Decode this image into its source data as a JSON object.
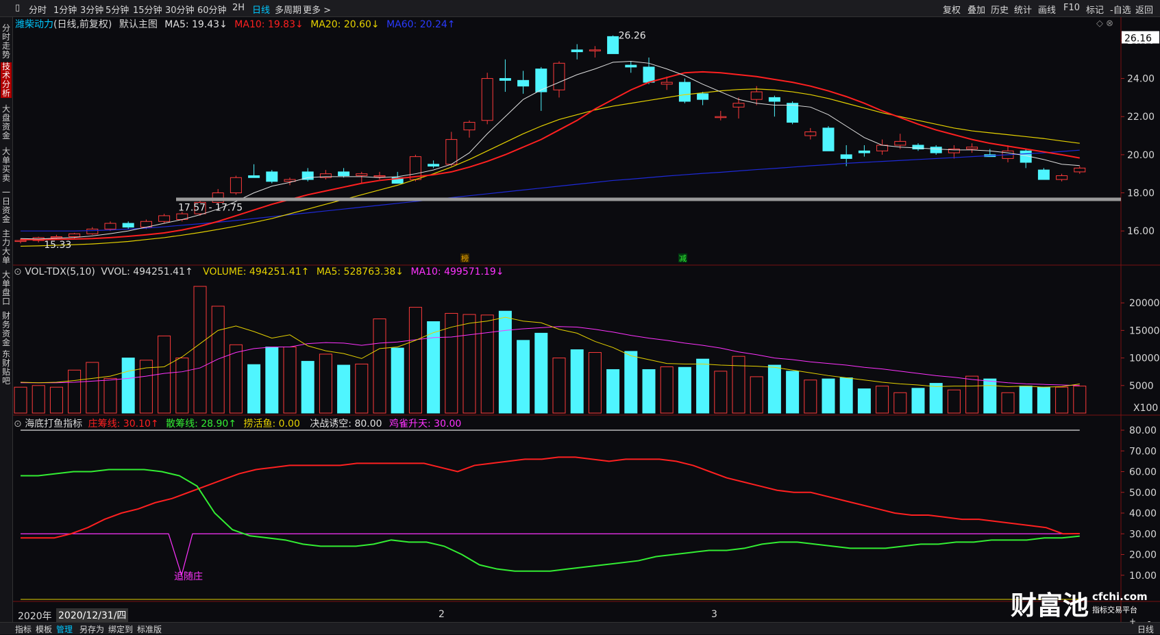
{
  "toolbar": {
    "left_items": [
      "分时",
      "1分钟",
      "3分钟",
      "5分钟",
      "15分钟",
      "30分钟",
      "60分钟",
      "2H",
      "日线",
      "多周期",
      "更多 >"
    ],
    "active_index": 8,
    "right_items": [
      "复权",
      "叠加",
      "历史",
      "统计",
      "画线",
      "F10",
      "标记",
      "-自选",
      "返回"
    ]
  },
  "sidebar": {
    "items": [
      "分时走势",
      "技术分析",
      "大盘资金",
      "大单买卖",
      "一日资金",
      "主力大单",
      "大单盘口",
      "财务资金",
      "东财贴吧"
    ],
    "active_index": 1
  },
  "main_header": {
    "stock": "潍柴动力",
    "mode": "(日线,前复权)",
    "template": "默认主图",
    "ma5": "MA5: 19.43↓",
    "ma10": "MA10: 19.83↓",
    "ma20": "MA20: 20.60↓",
    "ma60": "MA60: 20.24↑",
    "top_right_icons": "◇ ⊗"
  },
  "vol_header": {
    "name": "VOL-TDX(5,10)",
    "vvol": "VVOL: 494251.41↑",
    "volume": "VOLUME: 494251.41↑",
    "ma5": "MA5: 528763.38↓",
    "ma10": "MA10: 499571.19↓"
  },
  "ind_header": {
    "name": "海底打鱼指标",
    "l1": "庄筹线: 30.10↑",
    "l2": "散筹线: 28.90↑",
    "l3": "捞活鱼: 0.00",
    "l4": "决战诱空: 80.00",
    "l5": "鸡雀升天: 30.00"
  },
  "annotations": {
    "high": "26.26",
    "low": "15.33",
    "range": "17.57 - 17.75",
    "current_price": "26.16",
    "chase": "追随庄",
    "tag1": "榜",
    "tag2": "减",
    "vol_unit": "X100"
  },
  "date_axis": {
    "year": "2020年",
    "cursor_date": "2020/12/31/四",
    "labels": [
      "2",
      "3"
    ]
  },
  "bottom_tabs": [
    "指标",
    "模板",
    "管理",
    "另存为",
    "绑定到",
    "标准版"
  ],
  "bottom_active": 2,
  "bottom_right": [
    "日线",
    "+",
    "-"
  ],
  "watermark": {
    "brand": "财富池",
    "site": "cfchi.com",
    "slogan": "指标交易平台"
  },
  "colors": {
    "up": "#ff3b3b",
    "down": "#4ff5ff",
    "ma5": "#e0e0e0",
    "ma10": "#ff2020",
    "ma20": "#e6d200",
    "ma60": "#1e2ad8",
    "green": "#33ee33",
    "magenta": "#ff33ff"
  },
  "chart_data": [
    {
      "type": "candlestick",
      "title": "潍柴动力 (日线,前复权)",
      "ylim": [
        15,
        26.5
      ],
      "yticks": [
        "16.00",
        "18.00",
        "20.00",
        "22.00",
        "24.00",
        "26.00"
      ],
      "candles": [
        [
          15.5,
          15.6,
          15.35,
          15.5
        ],
        [
          15.5,
          15.7,
          15.4,
          15.65
        ],
        [
          15.65,
          15.8,
          15.55,
          15.7
        ],
        [
          15.7,
          15.9,
          15.6,
          15.85
        ],
        [
          15.85,
          16.2,
          15.8,
          16.1
        ],
        [
          16.1,
          16.5,
          16.0,
          16.4
        ],
        [
          16.4,
          16.5,
          16.1,
          16.2
        ],
        [
          16.2,
          16.6,
          16.1,
          16.5
        ],
        [
          16.5,
          16.9,
          16.4,
          16.8
        ],
        [
          16.6,
          17.0,
          16.5,
          16.9
        ],
        [
          16.9,
          17.6,
          16.8,
          17.5
        ],
        [
          17.5,
          18.2,
          17.4,
          18.0
        ],
        [
          18.0,
          18.9,
          17.9,
          18.8
        ],
        [
          18.9,
          19.5,
          18.8,
          18.8
        ],
        [
          19.1,
          19.2,
          18.5,
          18.6
        ],
        [
          18.6,
          18.8,
          18.4,
          18.7
        ],
        [
          19.1,
          19.3,
          18.6,
          18.7
        ],
        [
          18.8,
          19.2,
          18.7,
          19.0
        ],
        [
          19.1,
          19.3,
          18.8,
          18.9
        ],
        [
          18.9,
          19.1,
          18.5,
          19.0
        ],
        [
          18.9,
          19.1,
          18.7,
          18.9
        ],
        [
          18.8,
          19.1,
          18.6,
          18.5
        ],
        [
          18.7,
          20.0,
          18.6,
          19.9
        ],
        [
          19.5,
          19.7,
          19.3,
          19.4
        ],
        [
          19.5,
          21.2,
          19.4,
          20.8
        ],
        [
          21.3,
          21.8,
          20.9,
          21.7
        ],
        [
          21.8,
          24.3,
          21.6,
          24.0
        ],
        [
          24.0,
          25.0,
          23.3,
          23.9
        ],
        [
          23.9,
          24.4,
          23.2,
          23.6
        ],
        [
          24.5,
          24.6,
          22.3,
          23.3
        ],
        [
          23.4,
          24.9,
          23.0,
          24.8
        ],
        [
          25.5,
          25.8,
          25.0,
          25.4
        ],
        [
          25.5,
          25.7,
          25.1,
          25.5
        ],
        [
          26.2,
          26.26,
          25.3,
          25.3
        ],
        [
          24.7,
          24.9,
          24.3,
          24.6
        ],
        [
          24.6,
          25.1,
          23.7,
          23.8
        ],
        [
          23.7,
          24.1,
          23.4,
          23.8
        ],
        [
          23.8,
          24.0,
          22.7,
          22.8
        ],
        [
          23.2,
          23.3,
          22.6,
          22.9
        ],
        [
          22.0,
          22.3,
          21.8,
          22.0
        ],
        [
          22.5,
          23.0,
          21.9,
          22.7
        ],
        [
          22.9,
          23.6,
          22.6,
          23.3
        ],
        [
          23.0,
          23.1,
          22.0,
          22.8
        ],
        [
          22.7,
          22.8,
          21.6,
          21.7
        ],
        [
          21.0,
          21.4,
          20.8,
          21.2
        ],
        [
          21.4,
          21.5,
          20.2,
          20.2
        ],
        [
          20.0,
          20.5,
          19.4,
          19.8
        ],
        [
          20.2,
          20.5,
          19.9,
          20.1
        ],
        [
          20.2,
          20.8,
          20.0,
          20.5
        ],
        [
          20.5,
          21.1,
          20.3,
          20.7
        ],
        [
          20.5,
          20.6,
          20.2,
          20.3
        ],
        [
          20.4,
          20.5,
          20.0,
          20.1
        ],
        [
          20.1,
          20.5,
          19.8,
          20.3
        ],
        [
          20.3,
          20.6,
          20.1,
          20.4
        ],
        [
          20.0,
          20.3,
          19.9,
          19.9
        ],
        [
          19.8,
          20.5,
          19.6,
          20.2
        ],
        [
          20.2,
          20.3,
          19.3,
          19.6
        ],
        [
          19.2,
          19.3,
          18.7,
          18.7
        ],
        [
          18.7,
          19.0,
          18.6,
          18.9
        ],
        [
          19.1,
          19.4,
          19.0,
          19.3
        ]
      ],
      "ma5": [
        15.6,
        15.58,
        15.62,
        15.66,
        15.74,
        15.86,
        16.0,
        16.2,
        16.4,
        16.6,
        16.85,
        17.15,
        17.55,
        18.0,
        18.35,
        18.55,
        18.8,
        18.85,
        18.85,
        18.85,
        18.8,
        18.85,
        19.0,
        19.2,
        19.5,
        20.1,
        21.1,
        22.0,
        22.9,
        23.4,
        23.8,
        24.2,
        24.5,
        24.85,
        24.9,
        24.8,
        24.5,
        24.15,
        23.7,
        23.3,
        22.9,
        22.7,
        22.6,
        22.6,
        22.5,
        22.1,
        21.5,
        20.9,
        20.5,
        20.4,
        20.35,
        20.3,
        20.25,
        20.25,
        20.2,
        20.1,
        19.95,
        19.75,
        19.5,
        19.43
      ],
      "ma10": [
        15.55,
        15.55,
        15.56,
        15.58,
        15.6,
        15.65,
        15.72,
        15.8,
        15.9,
        16.05,
        16.25,
        16.5,
        16.8,
        17.1,
        17.4,
        17.65,
        17.9,
        18.1,
        18.3,
        18.5,
        18.65,
        18.75,
        18.85,
        18.95,
        19.1,
        19.35,
        19.65,
        20.0,
        20.4,
        20.8,
        21.3,
        21.8,
        22.4,
        22.9,
        23.4,
        23.8,
        24.05,
        24.3,
        24.35,
        24.3,
        24.2,
        24.1,
        23.95,
        23.8,
        23.6,
        23.35,
        23.05,
        22.7,
        22.3,
        21.95,
        21.6,
        21.3,
        21.05,
        20.8,
        20.6,
        20.45,
        20.3,
        20.15,
        20.0,
        19.83
      ],
      "ma20": [
        15.2,
        15.22,
        15.25,
        15.28,
        15.32,
        15.38,
        15.45,
        15.55,
        15.65,
        15.78,
        15.92,
        16.08,
        16.25,
        16.45,
        16.65,
        16.9,
        17.15,
        17.4,
        17.65,
        17.9,
        18.15,
        18.4,
        18.7,
        19.0,
        19.35,
        19.75,
        20.2,
        20.65,
        21.1,
        21.5,
        21.85,
        22.1,
        22.35,
        22.55,
        22.7,
        22.85,
        23.0,
        23.15,
        23.25,
        23.35,
        23.42,
        23.45,
        23.4,
        23.3,
        23.15,
        22.95,
        22.7,
        22.45,
        22.2,
        22.0,
        21.8,
        21.6,
        21.4,
        21.25,
        21.15,
        21.05,
        20.95,
        20.85,
        20.72,
        20.6
      ],
      "ma60": [
        16.0,
        16.0,
        16.0,
        16.0,
        16.02,
        16.05,
        16.1,
        16.15,
        16.22,
        16.3,
        16.38,
        16.46,
        16.55,
        16.65,
        16.75,
        16.85,
        16.95,
        17.05,
        17.15,
        17.25,
        17.35,
        17.45,
        17.55,
        17.65,
        17.75,
        17.85,
        17.95,
        18.05,
        18.15,
        18.25,
        18.35,
        18.45,
        18.55,
        18.65,
        18.72,
        18.8,
        18.88,
        18.95,
        19.02,
        19.08,
        19.15,
        19.22,
        19.28,
        19.35,
        19.42,
        19.48,
        19.55,
        19.6,
        19.65,
        19.7,
        19.75,
        19.8,
        19.85,
        19.9,
        19.95,
        20.0,
        20.05,
        20.1,
        20.17,
        20.24
      ]
    },
    {
      "type": "bar",
      "title": "VOL-TDX(5,10)",
      "unit": "X100",
      "ylim": [
        0,
        24000
      ],
      "yticks": [
        "5000",
        "10000",
        "15000",
        "20000"
      ],
      "values": [
        4700,
        5000,
        4700,
        7800,
        9200,
        6300,
        10000,
        9600,
        14000,
        10000,
        23000,
        19400,
        12400,
        8800,
        12000,
        12000,
        9400,
        10700,
        8700,
        8900,
        17100,
        11800,
        19200,
        16600,
        18100,
        17900,
        17800,
        18500,
        13200,
        14500,
        10000,
        11500,
        11000,
        7900,
        11200,
        7900,
        8400,
        8300,
        9800,
        7600,
        10300,
        6600,
        8700,
        7600,
        6000,
        6200,
        6400,
        4400,
        4900,
        3700,
        4500,
        5400,
        4200,
        6700,
        6200,
        3700,
        4900,
        4700,
        4700,
        4900
      ],
      "ma5": [
        5600,
        5500,
        5600,
        5900,
        6300,
        6700,
        7600,
        8200,
        8400,
        10200,
        12600,
        15000,
        15800,
        14800,
        13600,
        14200,
        12200,
        11300,
        10800,
        9900,
        11700,
        12000,
        13200,
        14600,
        15600,
        16300,
        16700,
        17400,
        16700,
        16400,
        15200,
        14500,
        13000,
        11900,
        10400,
        9700,
        9000,
        8900,
        8900,
        8700,
        8600,
        8500,
        8300,
        7800,
        7300,
        6800,
        6400,
        6000,
        5600,
        5300,
        5100,
        4800,
        4900,
        4900,
        5000,
        4800,
        4900,
        4700,
        4800,
        5288
      ],
      "ma10": [
        5500,
        5500,
        5500,
        5600,
        5800,
        6000,
        6300,
        6700,
        7200,
        7500,
        8200,
        9800,
        11000,
        11700,
        12000,
        12000,
        12600,
        12800,
        12700,
        12300,
        12700,
        12900,
        13300,
        13700,
        13800,
        14200,
        14600,
        15000,
        15300,
        15500,
        15700,
        15600,
        15200,
        14700,
        14100,
        13600,
        13200,
        12700,
        12300,
        11800,
        11100,
        10600,
        10000,
        9700,
        9300,
        9000,
        8700,
        8300,
        8000,
        7600,
        7200,
        6800,
        6500,
        6100,
        5800,
        5500,
        5300,
        5200,
        5100,
        4996
      ]
    },
    {
      "type": "line",
      "title": "海底打鱼指标",
      "ylim": [
        0,
        85
      ],
      "yticks": [
        "10.00",
        "20.00",
        "30.00",
        "40.00",
        "50.00",
        "60.00",
        "70.00",
        "80.00"
      ],
      "series": [
        {
          "name": "庄筹线",
          "color": "#ff2020",
          "values": [
            28,
            28,
            28,
            30,
            33,
            37,
            40,
            42,
            45,
            47,
            50,
            53,
            56,
            59,
            61,
            62,
            63,
            63,
            63,
            63,
            64,
            64,
            64,
            64,
            64,
            62,
            60,
            63,
            64,
            65,
            66,
            66,
            67,
            67,
            66,
            65,
            66,
            66,
            66,
            65,
            63,
            60,
            57,
            55,
            53,
            51,
            50,
            50,
            48,
            46,
            44,
            42,
            40,
            39,
            39,
            38,
            37,
            37,
            36,
            35,
            34,
            33,
            30,
            30.1
          ]
        },
        {
          "name": "散筹线",
          "color": "#33ee33",
          "values": [
            58,
            58,
            59,
            60,
            60,
            61,
            61,
            61,
            60,
            58,
            53,
            40,
            32,
            29,
            28,
            27,
            25,
            24,
            24,
            24,
            25,
            27,
            26,
            26,
            24,
            20,
            15,
            13,
            12,
            12,
            12,
            13,
            14,
            15,
            16,
            17,
            19,
            20,
            21,
            22,
            22,
            23,
            25,
            26,
            26,
            25,
            24,
            23,
            23,
            23,
            24,
            25,
            25,
            26,
            26,
            27,
            27,
            27,
            28,
            28,
            28.9
          ]
        },
        {
          "name": "捞活鱼",
          "color": "#e6d200",
          "values": [
            0
          ]
        },
        {
          "name": "决战诱空",
          "color": "#e0e0e0",
          "values": [
            80
          ]
        },
        {
          "name": "鸡雀升天",
          "color": "#ff33ff",
          "values": [
            30
          ]
        }
      ]
    }
  ]
}
